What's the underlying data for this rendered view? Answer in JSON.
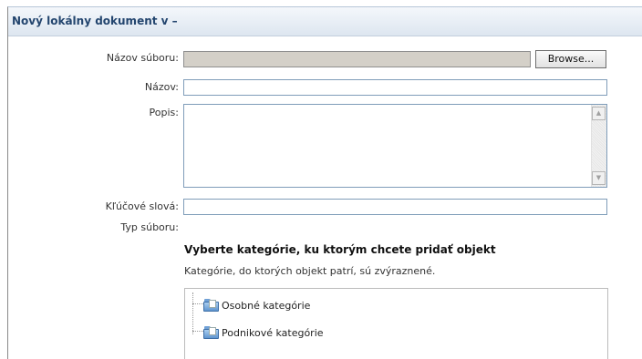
{
  "window": {
    "title": "Nový lokálny dokument v –"
  },
  "form": {
    "file_label": "Názov súboru:",
    "file_value": "",
    "browse_label": "Browse...",
    "name_label": "Názov:",
    "name_value": "",
    "description_label": "Popis:",
    "description_value": "",
    "keywords_label": "Kľúčové slová:",
    "keywords_value": "",
    "filetype_label": "Typ súboru:"
  },
  "categories": {
    "heading": "Vyberte kategórie, ku ktorým chcete pridať objekt",
    "subtext": "Kategórie, do ktorých objekt patrí, sú zvýraznené.",
    "items": [
      {
        "label": "Osobné kategórie",
        "icon": "category-folder-icon"
      },
      {
        "label": "Podnikové kategórie",
        "icon": "category-folder-icon"
      }
    ]
  },
  "icons": {
    "scroll_up": "scroll-up-arrow-icon",
    "scroll_down": "scroll-down-arrow-icon"
  },
  "colors": {
    "title_text": "#23456e",
    "input_border": "#7f9db9",
    "disabled_input": "#d4d0c8"
  }
}
